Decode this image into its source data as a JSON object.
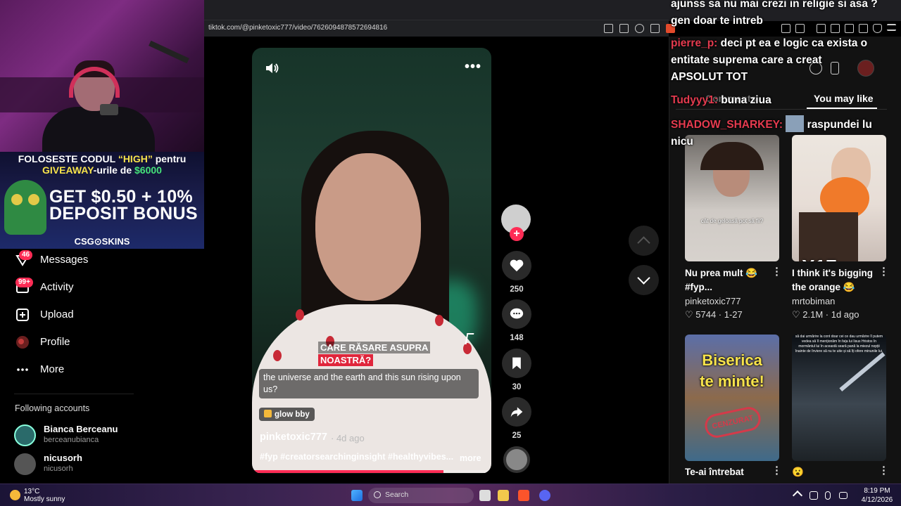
{
  "browser": {
    "url": "tiktok.com/@pinketoxic777/video/7626094878572694816"
  },
  "promo": {
    "line1_prefix": "FOLOSESTE CODUL ",
    "line1_code": "“HIGH”",
    "line1_suffix": " pentru",
    "line2_prefix": "GIVEAWAY",
    "line2_mid": "-urile de ",
    "line2_amount": "$6000",
    "bonus_line1": "GET $0.50 + 10%",
    "bonus_line2": "DEPOSIT BONUS",
    "brand": "CSG⊙SKINS"
  },
  "nav": {
    "items": [
      {
        "label": "Messages",
        "badge": "46",
        "icon": "paper-plane-icon"
      },
      {
        "label": "Activity",
        "badge": "99+",
        "icon": "inbox-icon"
      },
      {
        "label": "Upload",
        "icon": "plus-square-icon"
      },
      {
        "label": "Profile",
        "icon": "avatar-icon"
      },
      {
        "label": "More",
        "icon": "ellipsis-icon"
      }
    ],
    "following_header": "Following accounts",
    "following": [
      {
        "name": "Bianca Berceanu",
        "handle": "berceanubianca"
      },
      {
        "name": "nicusorh",
        "handle": "nicusorh"
      }
    ]
  },
  "video": {
    "overlay_caption_line1": "CARE RĂSARE ASUPRA",
    "overlay_caption_line2": "NOASTRĂ?",
    "subtitle": "the universe and the earth and this sun rising upon us?",
    "sound_label": "glow bby",
    "author": "pinketoxic777",
    "posted": "· 4d ago",
    "hashtags": "#fyp #creatorsearchinginsight #healthyvibes...",
    "more_label": "more",
    "progress": 0.8
  },
  "actions": {
    "likes": "250",
    "comments": "148",
    "saves": "30",
    "shares": "25"
  },
  "panel": {
    "tab_comments": "Comments",
    "tab_you_may_like": "You may like",
    "cards": [
      {
        "title": "Nu prea mult 😂 #fyp...",
        "author": "pinketoxic777",
        "stats": "♡ 5744 · 1-27",
        "thumb_text": "cât de geloasă pot să fii?"
      },
      {
        "title": "I think it's bigging the orange 😂",
        "author": "mrtobiman",
        "stats": "♡ 2.1M · 1d ago",
        "overlay_text": "X17"
      },
      {
        "title": "Te-ai întrebat",
        "thumb_line1": "Biserica",
        "thumb_line2": "te minte!",
        "stamp": "CENZURAT"
      },
      {
        "title": "😮",
        "thumb_text": "să dai urmărire la cont doar cei ce dau urmărire îl putem vedea să îl menționăm în fața lui Iisus Hristos în mormântul lui în această seară pană la miezul nopții înainte de înviere să nu te uite și să îți ofere minunile lui."
      }
    ]
  },
  "chat": [
    {
      "user": "",
      "text": "ajunss sa nu mai crezi in religie si asa ?"
    },
    {
      "user": "",
      "text": "gen doar te intreb"
    },
    {
      "user": "pierre_p:",
      "text": "deci pt ea e logic ca exista o"
    },
    {
      "user": "",
      "text": "entitate suprema care a creat"
    },
    {
      "user": "",
      "text": "APSOLUT TOT"
    },
    {
      "user": "Tudyyy1:",
      "text": "buna ziua"
    },
    {
      "user": "SHADOW_SHARKEY:",
      "text": "raspundei lu"
    },
    {
      "user": "",
      "text": "nicu"
    }
  ],
  "taskbar": {
    "temp": "13°C",
    "weather": "Mostly sunny",
    "search": "Search",
    "time": "8:19 PM",
    "date": "4/12/2026"
  },
  "colors": {
    "accent": "#fe2c55",
    "chat_user": "#e53b4f",
    "promo_code": "#f7e34b",
    "promo_amount": "#45e27a"
  }
}
